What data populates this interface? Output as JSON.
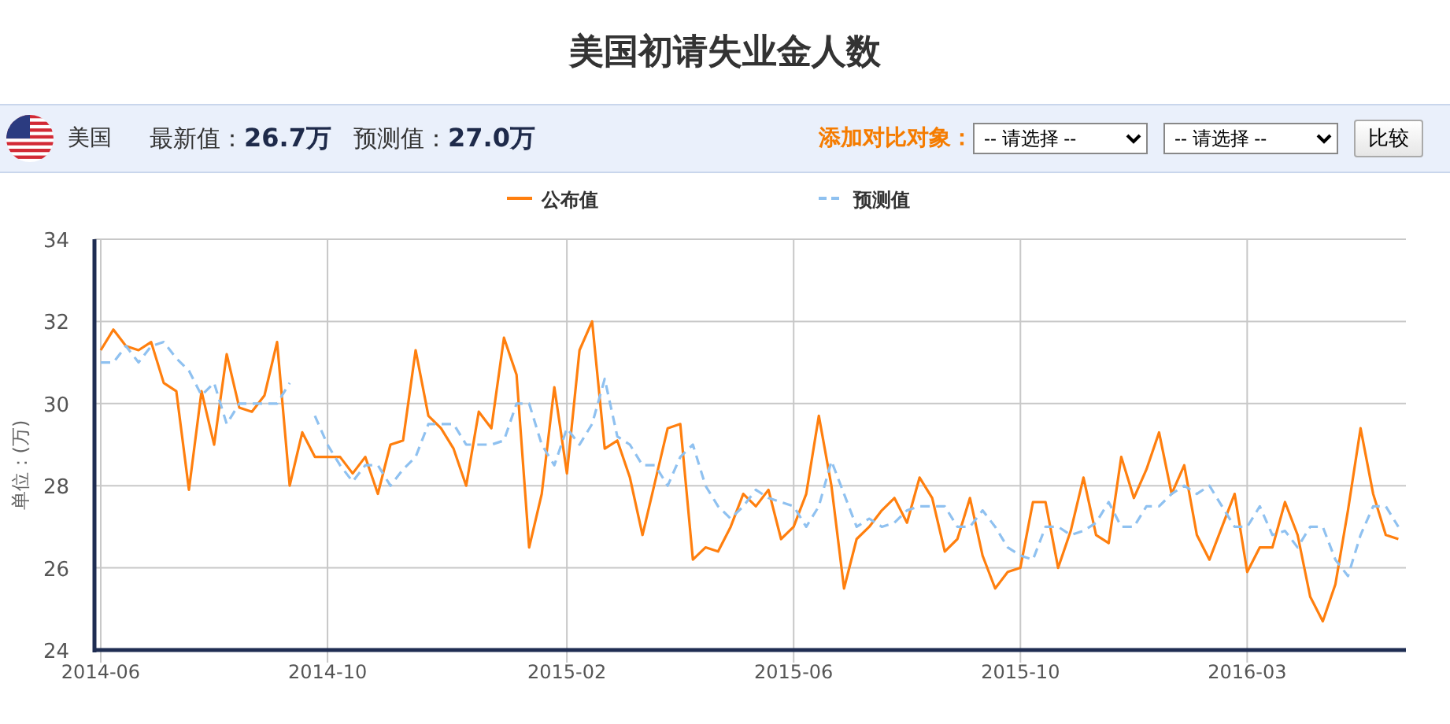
{
  "title": "美国初请失业金人数",
  "info_bar": {
    "country": "美国",
    "latest": {
      "label": "最新值：",
      "value": "26.7万"
    },
    "forecast": {
      "label": "预测值：",
      "value": "27.0万"
    },
    "compare": {
      "label": "添加对比对象：",
      "selects": [
        {
          "value": "-- 请选择 --"
        },
        {
          "value": "-- 请选择 --"
        }
      ],
      "button": "比较"
    }
  },
  "chart": {
    "chart_data": {
      "type": "line",
      "ylabel": "单位：(万)",
      "ylim": [
        24,
        34
      ],
      "yticks": [
        24,
        26,
        28,
        30,
        32,
        34
      ],
      "grid": true,
      "legend": "top",
      "categories": [
        "2014-06",
        null,
        null,
        null,
        null,
        null,
        null,
        null,
        null,
        null,
        null,
        null,
        null,
        null,
        null,
        null,
        null,
        null,
        "2014-10",
        null,
        null,
        null,
        null,
        null,
        null,
        null,
        null,
        null,
        null,
        null,
        null,
        null,
        null,
        null,
        null,
        null,
        null,
        "2015-02",
        null,
        null,
        null,
        null,
        null,
        null,
        null,
        null,
        null,
        null,
        null,
        null,
        null,
        null,
        null,
        null,
        null,
        "2015-06",
        null,
        null,
        null,
        null,
        null,
        null,
        null,
        null,
        null,
        null,
        null,
        null,
        null,
        null,
        null,
        null,
        null,
        "2015-10",
        null,
        null,
        null,
        null,
        null,
        null,
        null,
        null,
        null,
        null,
        null,
        null,
        null,
        null,
        null,
        null,
        null,
        "2016-03",
        null,
        null,
        null,
        null,
        null,
        null,
        null,
        null,
        null,
        null,
        null,
        null
      ],
      "series": [
        {
          "name": "公布值",
          "color": "#ff7f0e",
          "line_style": "solid",
          "values": [
            31.3,
            31.8,
            31.4,
            31.3,
            31.5,
            30.5,
            30.3,
            27.9,
            30.3,
            29.0,
            31.2,
            29.9,
            29.8,
            30.2,
            31.5,
            28.0,
            29.3,
            28.7,
            28.7,
            28.7,
            28.3,
            28.7,
            27.8,
            29.0,
            29.1,
            31.3,
            29.7,
            29.4,
            28.9,
            28.0,
            29.8,
            29.4,
            31.6,
            30.7,
            26.5,
            27.8,
            30.4,
            28.3,
            31.3,
            32.0,
            28.9,
            29.1,
            28.2,
            26.8,
            28.1,
            29.4,
            29.5,
            26.2,
            26.5,
            26.4,
            27.0,
            27.8,
            27.5,
            27.9,
            26.7,
            27.0,
            27.8,
            29.7,
            28.0,
            25.5,
            26.7,
            27.0,
            27.4,
            27.7,
            27.1,
            28.2,
            27.7,
            26.4,
            26.7,
            27.7,
            26.3,
            25.5,
            25.9,
            26.0,
            27.6,
            27.6,
            26.0,
            26.9,
            28.2,
            26.8,
            26.6,
            28.7,
            27.7,
            28.4,
            29.3,
            27.8,
            28.5,
            26.8,
            26.2,
            27.0,
            27.8,
            25.9,
            26.5,
            26.5,
            27.6,
            26.8,
            25.3,
            24.7,
            25.6,
            27.4,
            29.4,
            27.8,
            26.8,
            26.7
          ]
        },
        {
          "name": "预测值",
          "color": "#8fc1f0",
          "line_style": "dashed",
          "values": [
            31.0,
            31.0,
            31.4,
            31.0,
            31.4,
            31.5,
            31.1,
            30.8,
            30.2,
            30.5,
            29.5,
            30.0,
            30.0,
            30.0,
            30.0,
            30.5,
            null,
            29.7,
            29.0,
            28.5,
            28.1,
            28.5,
            28.5,
            28.0,
            28.4,
            28.7,
            29.5,
            29.5,
            29.5,
            29.0,
            29.0,
            29.0,
            29.1,
            30.0,
            30.0,
            29.0,
            28.5,
            29.4,
            29.0,
            29.5,
            30.6,
            29.2,
            29.0,
            28.5,
            28.5,
            28.0,
            28.7,
            29.0,
            28.0,
            27.5,
            27.2,
            27.5,
            27.9,
            27.7,
            27.6,
            27.5,
            27.0,
            27.5,
            28.6,
            27.8,
            27.0,
            27.2,
            27.0,
            27.1,
            27.4,
            27.5,
            27.5,
            27.5,
            27.0,
            27.0,
            27.4,
            27.0,
            26.5,
            26.3,
            26.2,
            27.0,
            27.0,
            26.8,
            26.9,
            27.1,
            27.6,
            27.0,
            27.0,
            27.5,
            27.5,
            27.8,
            28.0,
            27.8,
            28.0,
            27.5,
            27.0,
            27.0,
            27.5,
            26.8,
            26.9,
            26.5,
            27.0,
            27.0,
            26.2,
            25.8,
            26.8,
            27.5,
            27.5,
            27.0
          ]
        }
      ]
    }
  }
}
